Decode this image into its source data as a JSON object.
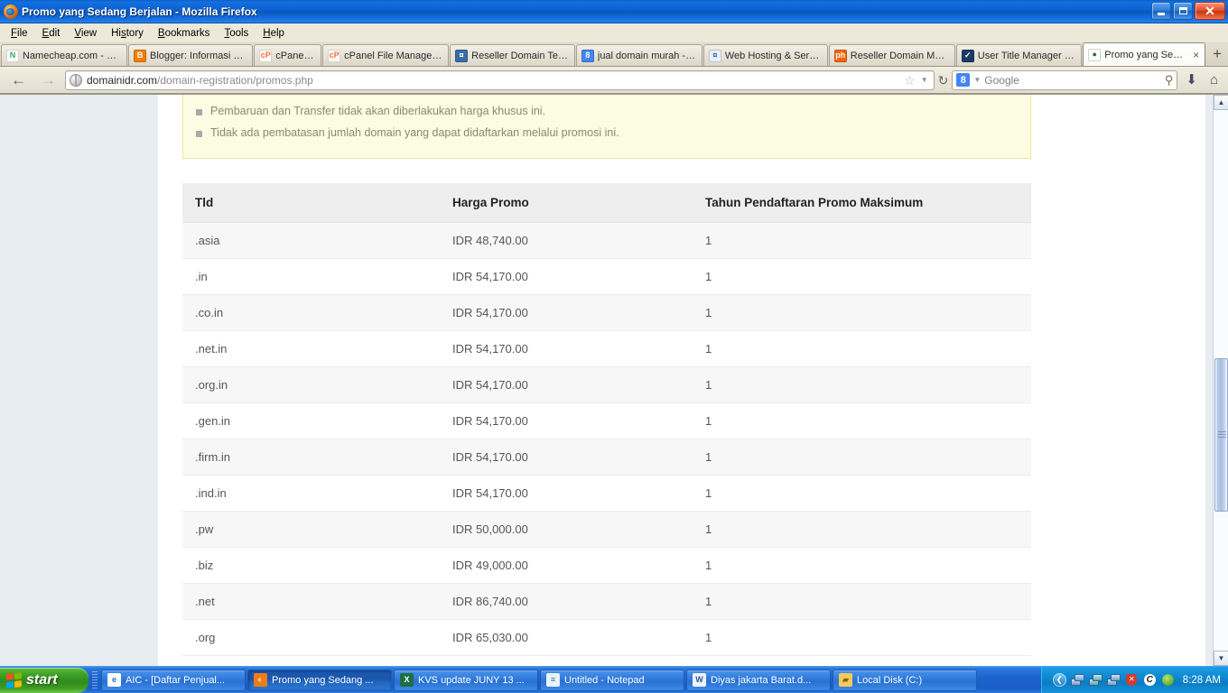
{
  "window": {
    "title": "Promo yang Sedang Berjalan - Mozilla Firefox",
    "app_icon": "firefox-icon",
    "minimize_label": "Minimize",
    "maximize_label": "Restore",
    "close_label": "Close"
  },
  "menubar": {
    "items": [
      {
        "label": "File",
        "accel": "F"
      },
      {
        "label": "Edit",
        "accel": "E"
      },
      {
        "label": "View",
        "accel": "V"
      },
      {
        "label": "History",
        "accel": "s"
      },
      {
        "label": "Bookmarks",
        "accel": "B"
      },
      {
        "label": "Tools",
        "accel": "T"
      },
      {
        "label": "Help",
        "accel": "H"
      }
    ]
  },
  "tabs": {
    "items": [
      {
        "label": "Namecheap.com - M...",
        "favicon": "namecheap-icon",
        "favicon_bg": "#ffffff",
        "favicon_fg": "#34a853",
        "favicon_glyph": "N",
        "active": false
      },
      {
        "label": "Blogger: Informasi d...",
        "favicon": "blogger-icon",
        "favicon_bg": "#f57d00",
        "favicon_fg": "#ffffff",
        "favicon_glyph": "B",
        "active": false
      },
      {
        "label": "cPanel X",
        "favicon": "cpanel-icon",
        "favicon_bg": "#ffffff",
        "favicon_fg": "#ff6c2c",
        "favicon_glyph": "cP",
        "active": false
      },
      {
        "label": "cPanel File Manager...",
        "favicon": "cpanel-icon",
        "favicon_bg": "#ffffff",
        "favicon_fg": "#ff6c2c",
        "favicon_glyph": "cP",
        "active": false
      },
      {
        "label": "Reseller Domain Ter...",
        "favicon": "generic-site-icon",
        "favicon_bg": "#3a6ea5",
        "favicon_fg": "#ffffff",
        "favicon_glyph": "¤",
        "active": false
      },
      {
        "label": "jual domain murah - ...",
        "favicon": "google-icon",
        "favicon_bg": "#4285f4",
        "favicon_fg": "#ffffff",
        "favicon_glyph": "8",
        "active": false
      },
      {
        "label": "Web Hosting & Serv...",
        "favicon": "generic-site-icon",
        "favicon_bg": "#e8f0fb",
        "favicon_fg": "#2a6bb5",
        "favicon_glyph": "¤",
        "active": false
      },
      {
        "label": "Reseller Domain Mur...",
        "favicon": "php-icon",
        "favicon_bg": "#f2640a",
        "favicon_fg": "#ffffff",
        "favicon_glyph": "ph",
        "active": false
      },
      {
        "label": "User Title Manager -...",
        "favicon": "user-title-icon",
        "favicon_bg": "#1b3a6b",
        "favicon_fg": "#ffffff",
        "favicon_glyph": "✓",
        "active": false
      },
      {
        "label": "Promo yang Sed...",
        "favicon": "domainidr-icon",
        "favicon_bg": "#ffffff",
        "favicon_fg": "#2e6e38",
        "favicon_glyph": "●",
        "active": true
      }
    ],
    "close_label": "×",
    "newtab_label": "+"
  },
  "navbar": {
    "back_label": "←",
    "forward_label": "→",
    "url_domain": "domainidr.com",
    "url_path": "/domain-registration/promos.php",
    "bookmark_star": "☆",
    "dropdown_caret": "▼",
    "reload_label": "↻",
    "search_engine": "Google",
    "search_engine_glyph": "8",
    "search_placeholder": "Google",
    "search_value": "",
    "magnifier": "⚲",
    "download_label": "⬇",
    "home_label": "⌂"
  },
  "page": {
    "notice": {
      "bullets": [
        "Pembaruan dan Transfer tidak akan diberlakukan harga khusus ini.",
        "Tidak ada pembatasan jumlah domain yang dapat didaftarkan melalui promosi ini."
      ]
    },
    "table": {
      "headers": [
        "Tld",
        "Harga Promo",
        "Tahun Pendaftaran Promo Maksimum"
      ],
      "rows": [
        {
          "tld": ".asia",
          "price": "IDR 48,740.00",
          "years": "1"
        },
        {
          "tld": ".in",
          "price": "IDR 54,170.00",
          "years": "1"
        },
        {
          "tld": ".co.in",
          "price": "IDR 54,170.00",
          "years": "1"
        },
        {
          "tld": ".net.in",
          "price": "IDR 54,170.00",
          "years": "1"
        },
        {
          "tld": ".org.in",
          "price": "IDR 54,170.00",
          "years": "1"
        },
        {
          "tld": ".gen.in",
          "price": "IDR 54,170.00",
          "years": "1"
        },
        {
          "tld": ".firm.in",
          "price": "IDR 54,170.00",
          "years": "1"
        },
        {
          "tld": ".ind.in",
          "price": "IDR 54,170.00",
          "years": "1"
        },
        {
          "tld": ".pw",
          "price": "IDR 50,000.00",
          "years": "1"
        },
        {
          "tld": ".biz",
          "price": "IDR 49,000.00",
          "years": "1"
        },
        {
          "tld": ".net",
          "price": "IDR 86,740.00",
          "years": "1"
        },
        {
          "tld": ".org",
          "price": "IDR 65,030.00",
          "years": "1"
        }
      ]
    }
  },
  "scrollbar": {
    "up_label": "▲",
    "down_label": "▼"
  },
  "taskbar": {
    "start_label": "start",
    "buttons": [
      {
        "label": "AIC - [Daftar Penjual...",
        "icon": "ie-icon",
        "icon_bg": "#ffffff",
        "icon_fg": "#1f73c4",
        "icon_glyph": "e",
        "active": false
      },
      {
        "label": "Promo yang Sedang ...",
        "icon": "firefox-icon",
        "icon_bg": "#ef7d17",
        "icon_fg": "#ffffff",
        "icon_glyph": "◐",
        "active": true
      },
      {
        "label": "KVS update JUNY 13 ...",
        "icon": "excel-icon",
        "icon_bg": "#1d7044",
        "icon_fg": "#ffffff",
        "icon_glyph": "X",
        "active": false
      },
      {
        "label": "Untitled - Notepad",
        "icon": "notepad-icon",
        "icon_bg": "#e8f2fb",
        "icon_fg": "#3a6ea5",
        "icon_glyph": "≡",
        "active": false
      },
      {
        "label": "Diyas jakarta Barat.d...",
        "icon": "word-icon",
        "icon_bg": "#eef3fb",
        "icon_fg": "#2a5699",
        "icon_glyph": "W",
        "active": false
      },
      {
        "label": "Local Disk (C:)",
        "icon": "folder-icon",
        "icon_bg": "#f7c95c",
        "icon_fg": "#8a6310",
        "icon_glyph": "▰",
        "active": false
      }
    ],
    "tray": {
      "expand_label": "❮",
      "icons": [
        {
          "name": "network-icon",
          "glyph": ""
        },
        {
          "name": "network-disconnected-icon",
          "glyph": ""
        },
        {
          "name": "network-icon",
          "glyph": ""
        },
        {
          "name": "security-alert-icon",
          "glyph": "✕"
        },
        {
          "name": "antivirus-icon",
          "glyph": "C"
        },
        {
          "name": "update-icon",
          "glyph": "✿"
        }
      ],
      "clock": "8:28 AM"
    }
  }
}
